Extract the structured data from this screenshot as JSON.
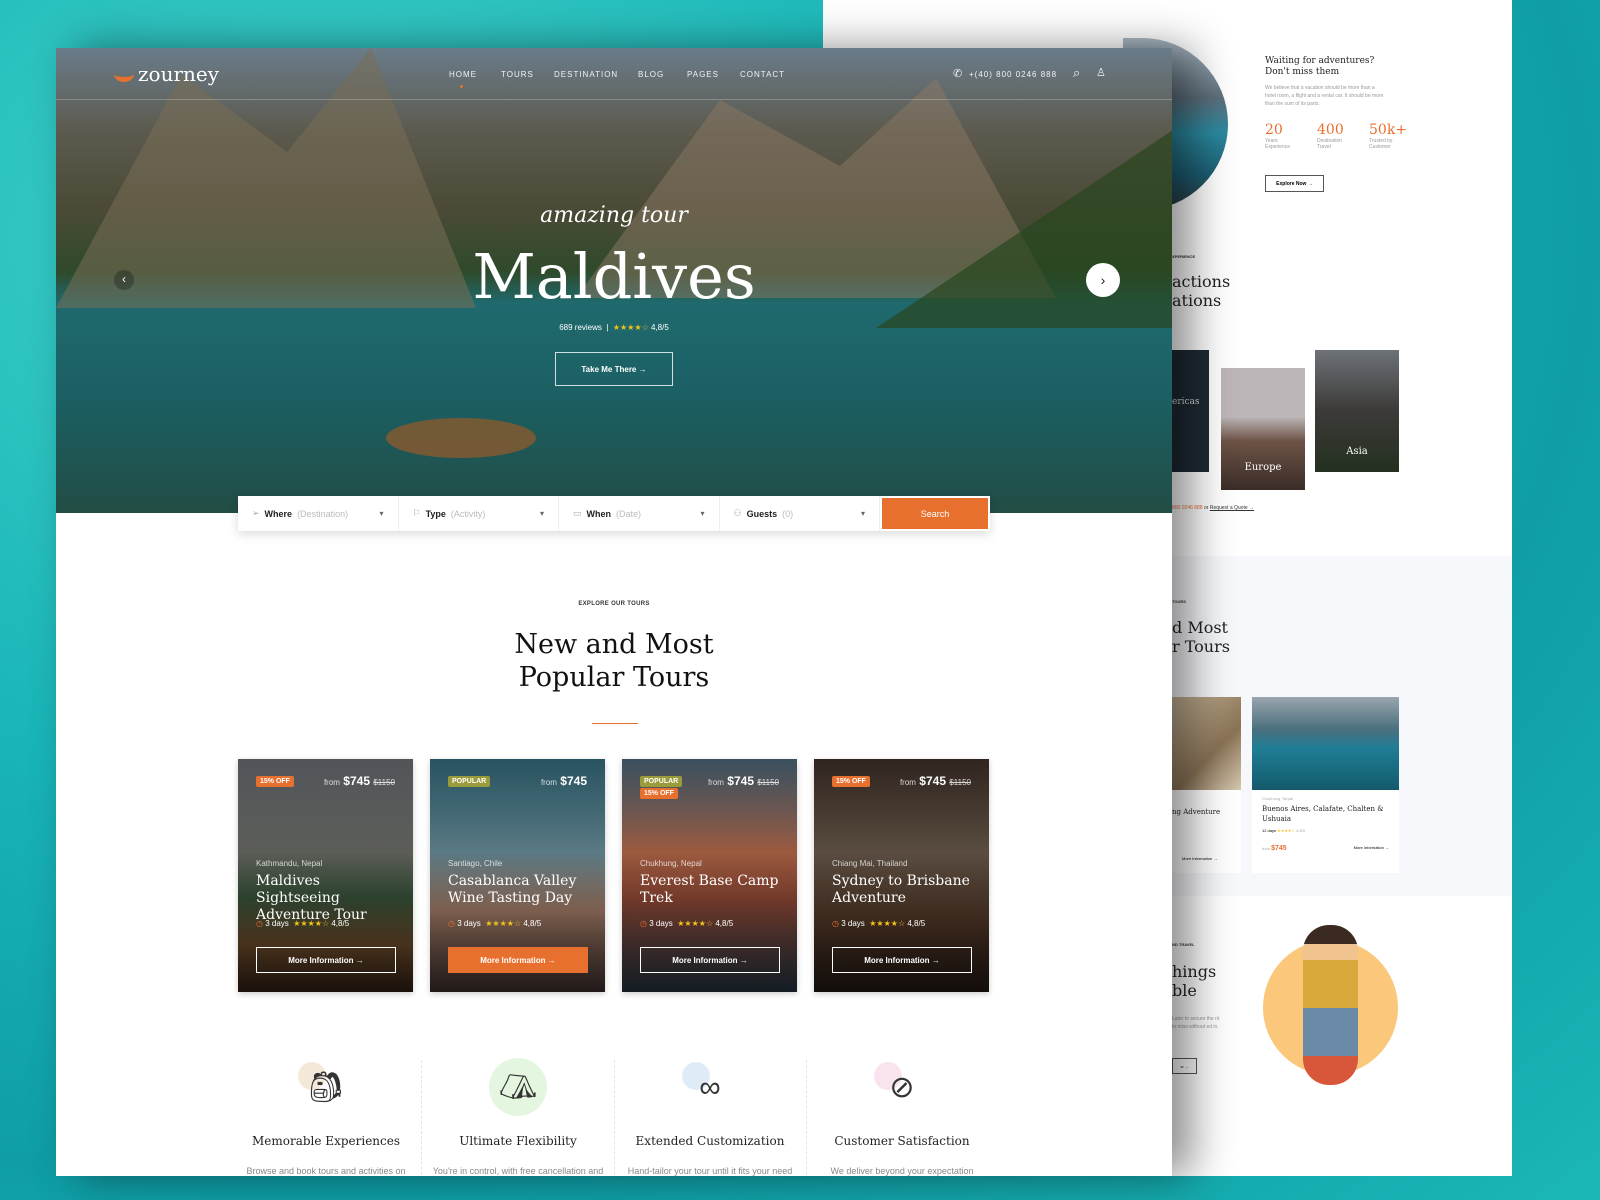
{
  "colors": {
    "accent": "#e8702f",
    "popular": "#9a9c3c",
    "background": "#19b5b8"
  },
  "nav": {
    "logo": "zourney",
    "items": [
      "HOME",
      "TOURS",
      "DESTINATION",
      "BLOG",
      "PAGES",
      "CONTACT"
    ],
    "active": "HOME",
    "phone": "+(40) 800 0246 888",
    "icons": [
      "phone-icon",
      "search-icon",
      "user-icon"
    ]
  },
  "hero": {
    "script": "amazing tour",
    "title": "Maldives",
    "reviews": "689 reviews",
    "stars": "★★★★☆",
    "rating": "4,8/5",
    "cta": "Take Me There →",
    "prev": "‹",
    "next": "›"
  },
  "search": {
    "fields": [
      {
        "label": "Where",
        "placeholder": "(Destination)",
        "icon": "location-arrow-icon"
      },
      {
        "label": "Type",
        "placeholder": "(Activity)",
        "icon": "flag-icon"
      },
      {
        "label": "When",
        "placeholder": "(Date)",
        "icon": "calendar-icon"
      },
      {
        "label": "Guests",
        "placeholder": "(0)",
        "icon": "users-icon"
      }
    ],
    "button": "Search"
  },
  "tours": {
    "eyebrow": "EXPLORE OUR TOURS",
    "title_line1": "New and Most",
    "title_line2": "Popular Tours",
    "cards": [
      {
        "badges": [
          "15% OFF"
        ],
        "from": "from",
        "price": "$745",
        "old": "$1150",
        "location": "Kathmandu, Nepal",
        "title": "Maldives Sightseeing Adventure Tour",
        "days": "3 days",
        "stars": "★★★★☆",
        "rating": "4,8/5",
        "button": "More Information →"
      },
      {
        "badges": [
          "POPULAR"
        ],
        "from": "from",
        "price": "$745",
        "old": "",
        "location": "Santiago, Chile",
        "title": "Casablanca Valley Wine Tasting Day",
        "days": "3 days",
        "stars": "★★★★☆",
        "rating": "4,8/5",
        "button": "More Information →"
      },
      {
        "badges": [
          "POPULAR",
          "15% OFF"
        ],
        "from": "from",
        "price": "$745",
        "old": "$1150",
        "location": "Chukhung, Nepal",
        "title": "Everest Base Camp Trek",
        "days": "3 days",
        "stars": "★★★★☆",
        "rating": "4,8/5",
        "button": "More Information →"
      },
      {
        "badges": [
          "15% OFF"
        ],
        "from": "from",
        "price": "$745",
        "old": "$1150",
        "location": "Chiang Mai, Thailand",
        "title": "Sydney to Brisbane Adventure",
        "days": "3 days",
        "stars": "★★★★☆",
        "rating": "4,8/5",
        "button": "More Information →"
      }
    ]
  },
  "features": [
    {
      "title": "Memorable Experiences",
      "text": "Browse and book tours and activities on incredible",
      "icon": "backpack-icon"
    },
    {
      "title": "Ultimate Flexibility",
      "text": "You're in control, with free cancellation and payment",
      "icon": "tent-icon"
    },
    {
      "title": "Extended Customization",
      "text": "Hand-tailor your tour until it fits your need",
      "icon": "binoculars-icon"
    },
    {
      "title": "Customer Satisfaction",
      "text": "We deliver beyond your expectation",
      "icon": "compass-icon"
    }
  ],
  "back": {
    "about": {
      "title_line1": "Waiting for adventures?",
      "title_line2": "Don't miss them",
      "text": "We believe that a vacation should be more than a hotel room, a flight and a rental car. It should be more than the sum of its parts.",
      "stats": [
        {
          "value": "20",
          "label": "Years Experience"
        },
        {
          "value": "400",
          "label": "Destination Travel"
        },
        {
          "value": "50k+",
          "label": "Trusted by Customer"
        }
      ],
      "button": "Explore Now →"
    },
    "attractions": {
      "eyebrow": "XPERIENCE",
      "title_line1": "actions",
      "title_line2": "ations",
      "regions": [
        "ericas",
        "Europe",
        "Asia"
      ],
      "contact": "800 0246 888",
      "or": "or",
      "quote": "Request a Quote →"
    },
    "tours": {
      "eyebrow": "TOURS",
      "title_line1": "d Most",
      "title_line2": "r Tours",
      "card1_title": "ng Adventure",
      "card1_more": "More Information →",
      "card2": {
        "location": "Chukhung, Nepal",
        "title": "Buenos Aires, Calafate, Chalten & Ushuaia",
        "days": "12 days",
        "stars": "★★★★☆",
        "rating": "4,8/5",
        "from": "from",
        "price": "$745",
        "more": "More Information →"
      }
    },
    "things": {
      "eyebrow": "ND TRAVEL",
      "title_line1": "hings",
      "title_line2": "ble",
      "text": "Later to secure the nt to miss without ed in.",
      "button": "w →"
    }
  }
}
